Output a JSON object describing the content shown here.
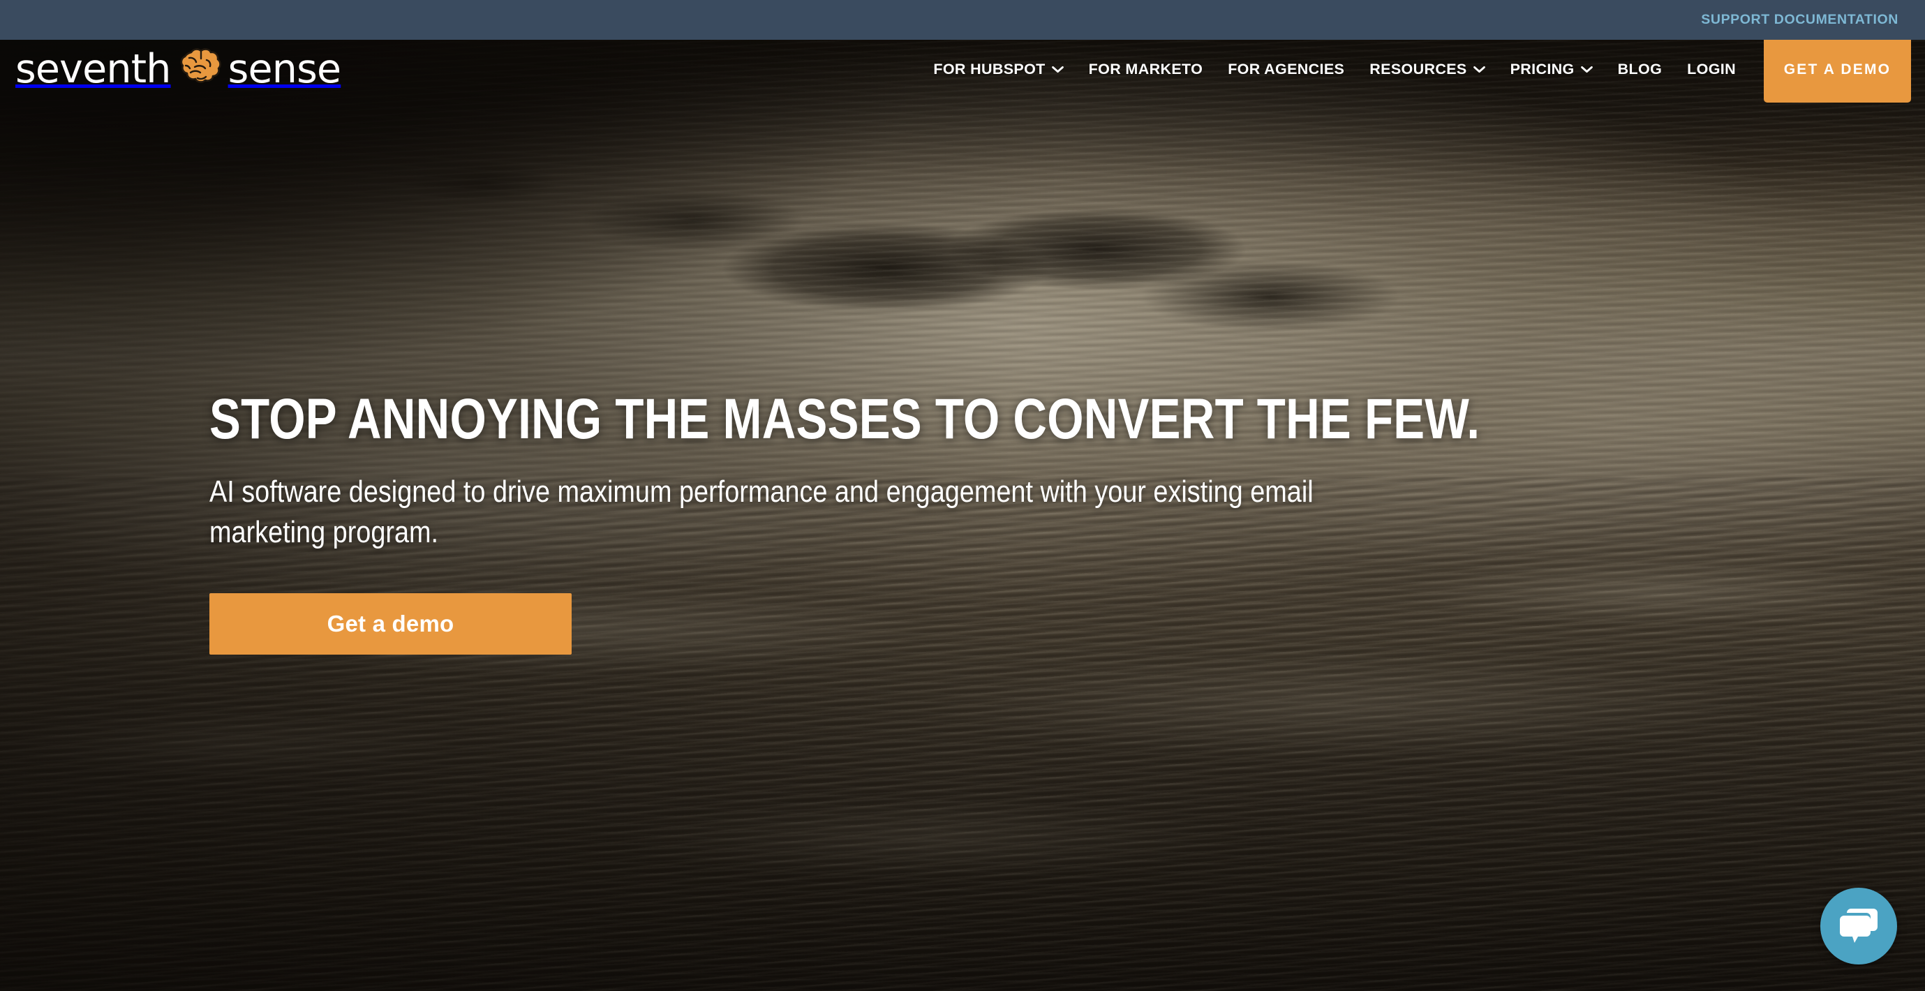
{
  "topbar": {
    "support_link": "SUPPORT DOCUMENTATION",
    "background_color": "#3a4b5f",
    "link_color": "#7eb8d4"
  },
  "navbar": {
    "logo": {
      "word_one": "seventh",
      "word_two": "sense",
      "icon": "brain-icon",
      "icon_color": "#e8983f",
      "text_color": "#ffffff"
    },
    "items": [
      {
        "label": "FOR HUBSPOT",
        "has_dropdown": true
      },
      {
        "label": "FOR MARKETO",
        "has_dropdown": false
      },
      {
        "label": "FOR AGENCIES",
        "has_dropdown": false
      },
      {
        "label": "RESOURCES",
        "has_dropdown": true
      },
      {
        "label": "PRICING",
        "has_dropdown": true
      },
      {
        "label": "BLOG",
        "has_dropdown": false
      },
      {
        "label": "LOGIN",
        "has_dropdown": false
      }
    ],
    "cta_label": "GET A DEMO",
    "cta_color": "#e8983f"
  },
  "hero": {
    "headline": "STOP ANNOYING THE MASSES TO CONVERT THE FEW.",
    "subheadline": "AI software designed to drive maximum performance and engagement with your existing email marketing program.",
    "button_label": "Get a demo",
    "button_color": "#e8983f",
    "background_image": "ocean-surf-rocks-photo"
  },
  "chat": {
    "icon": "chat-bubble-icon",
    "color": "#4ba3c3"
  }
}
